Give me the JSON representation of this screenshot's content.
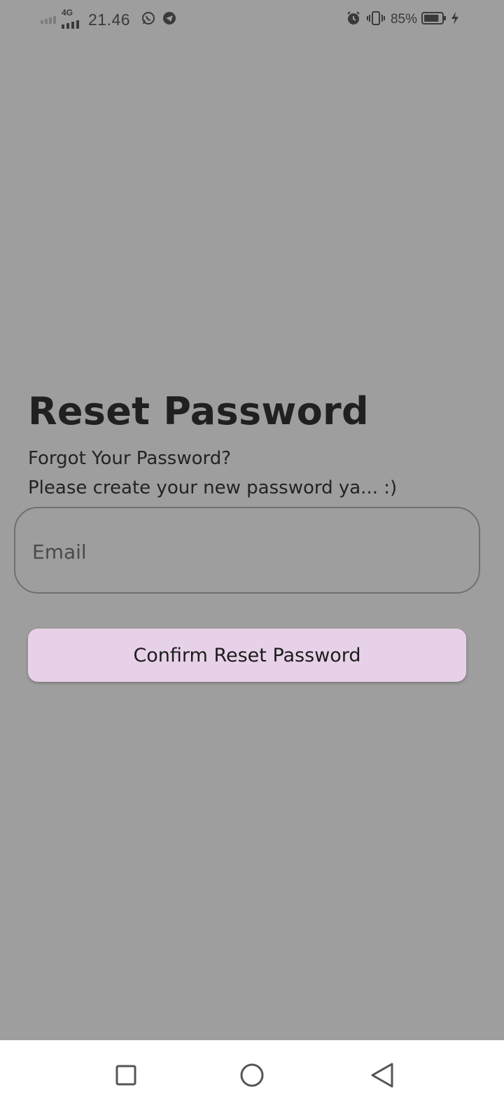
{
  "status_bar": {
    "network": "4G",
    "time": "21.46",
    "battery_percent": "85%",
    "battery_level": 0.85,
    "icons_left": [
      "signal-icon-1",
      "signal-icon-2",
      "whatsapp-icon",
      "telegram-icon"
    ],
    "icons_right": [
      "alarm-icon",
      "vibrate-icon",
      "battery-icon",
      "charging-icon"
    ]
  },
  "page": {
    "title": "Reset Password",
    "subtitle_line1": "Forgot Your Password?",
    "subtitle_line2": "Please create your new password ya... :)"
  },
  "form": {
    "email_placeholder": "Email",
    "email_value": "",
    "confirm_label": "Confirm Reset Password"
  },
  "colors": {
    "background": "#9e9e9e",
    "button_bg": "#e7d1e8",
    "nav_bg": "#ffffff"
  },
  "nav_bar": {
    "buttons": [
      "recents-icon",
      "home-icon",
      "back-icon"
    ]
  }
}
